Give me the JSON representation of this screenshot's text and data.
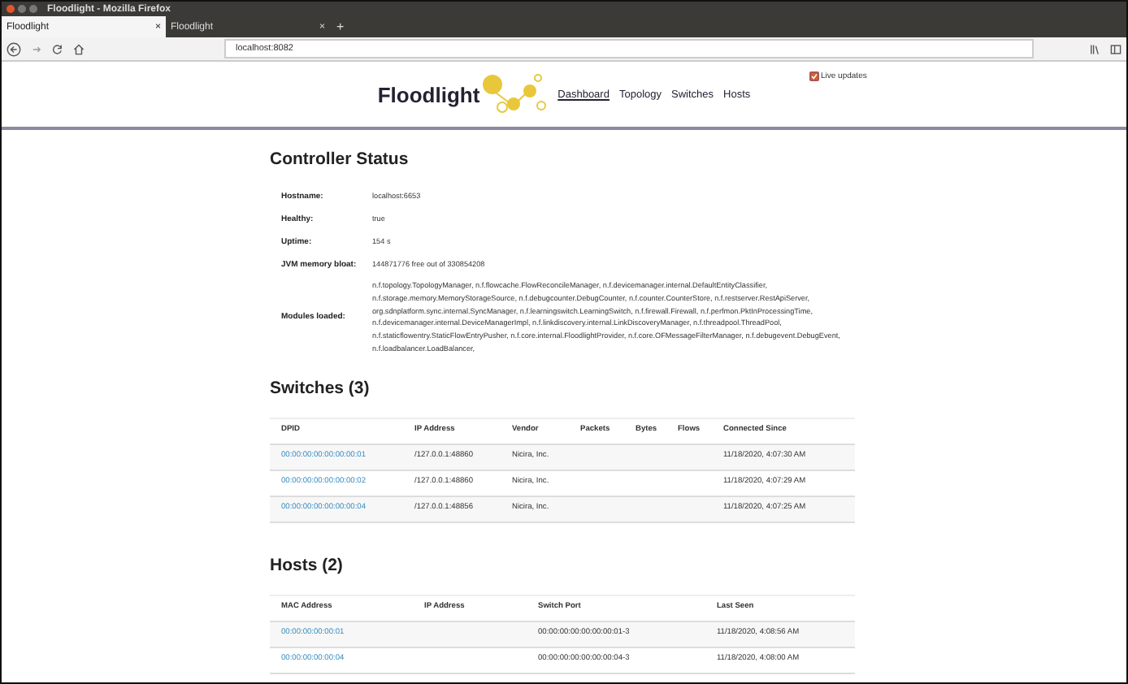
{
  "window": {
    "title": "Floodlight - Mozilla Firefox"
  },
  "tabs": [
    {
      "label": "Floodlight",
      "selected": true,
      "close": "×"
    },
    {
      "label": "Floodlight",
      "selected": false,
      "close": "×"
    }
  ],
  "new_tab": "+",
  "address_bar": {
    "url": "localhost:8082"
  },
  "header": {
    "logo": "Floodlight",
    "nav": [
      {
        "label": "Dashboard",
        "selected": true
      },
      {
        "label": "Topology",
        "selected": false
      },
      {
        "label": "Switches",
        "selected": false
      },
      {
        "label": "Hosts",
        "selected": false
      }
    ],
    "live_updates": {
      "label": "Live updates",
      "checked": true
    }
  },
  "controller_status": {
    "title": "Controller Status",
    "rows": [
      {
        "label": "Hostname:",
        "value": "localhost:6653"
      },
      {
        "label": "Healthy:",
        "value": "true"
      },
      {
        "label": "Uptime:",
        "value": "154 s"
      },
      {
        "label": "JVM memory bloat:",
        "value": "144871776 free out of 330854208"
      },
      {
        "label": "Modules loaded:",
        "value": "n.f.topology.TopologyManager, n.f.flowcache.FlowReconcileManager, n.f.devicemanager.internal.DefaultEntityClassifier, n.f.storage.memory.MemoryStorageSource, n.f.debugcounter.DebugCounter, n.f.counter.CounterStore, n.f.restserver.RestApiServer, org.sdnplatform.sync.internal.SyncManager, n.f.learningswitch.LearningSwitch, n.f.firewall.Firewall, n.f.perfmon.PktInProcessingTime, n.f.devicemanager.internal.DeviceManagerImpl, n.f.linkdiscovery.internal.LinkDiscoveryManager, n.f.threadpool.ThreadPool, n.f.staticflowentry.StaticFlowEntryPusher, n.f.core.internal.FloodlightProvider, n.f.core.OFMessageFilterManager, n.f.debugevent.DebugEvent, n.f.loadbalancer.LoadBalancer,"
      }
    ]
  },
  "switches": {
    "title": "Switches (3)",
    "columns": [
      "DPID",
      "IP Address",
      "Vendor",
      "Packets",
      "Bytes",
      "Flows",
      "Connected Since"
    ],
    "rows": [
      [
        "00:00:00:00:00:00:00:01",
        "/127.0.0.1:48860",
        "Nicira, Inc.",
        "",
        "",
        "",
        "11/18/2020, 4:07:30 AM"
      ],
      [
        "00:00:00:00:00:00:00:02",
        "/127.0.0.1:48860",
        "Nicira, Inc.",
        "",
        "",
        "",
        "11/18/2020, 4:07:29 AM"
      ],
      [
        "00:00:00:00:00:00:00:04",
        "/127.0.0.1:48856",
        "Nicira, Inc.",
        "",
        "",
        "",
        "11/18/2020, 4:07:25 AM"
      ]
    ]
  },
  "hosts": {
    "title": "Hosts (2)",
    "columns": [
      "MAC Address",
      "IP Address",
      "Switch Port",
      "Last Seen"
    ],
    "rows": [
      [
        "00:00:00:00:00:01",
        "",
        "00:00:00:00:00:00:00:01-3",
        "11/18/2020, 4:08:56 AM"
      ],
      [
        "00:00:00:00:00:04",
        "",
        "00:00:00:00:00:00:00:04-3",
        "11/18/2020, 4:08:00 AM"
      ]
    ]
  }
}
